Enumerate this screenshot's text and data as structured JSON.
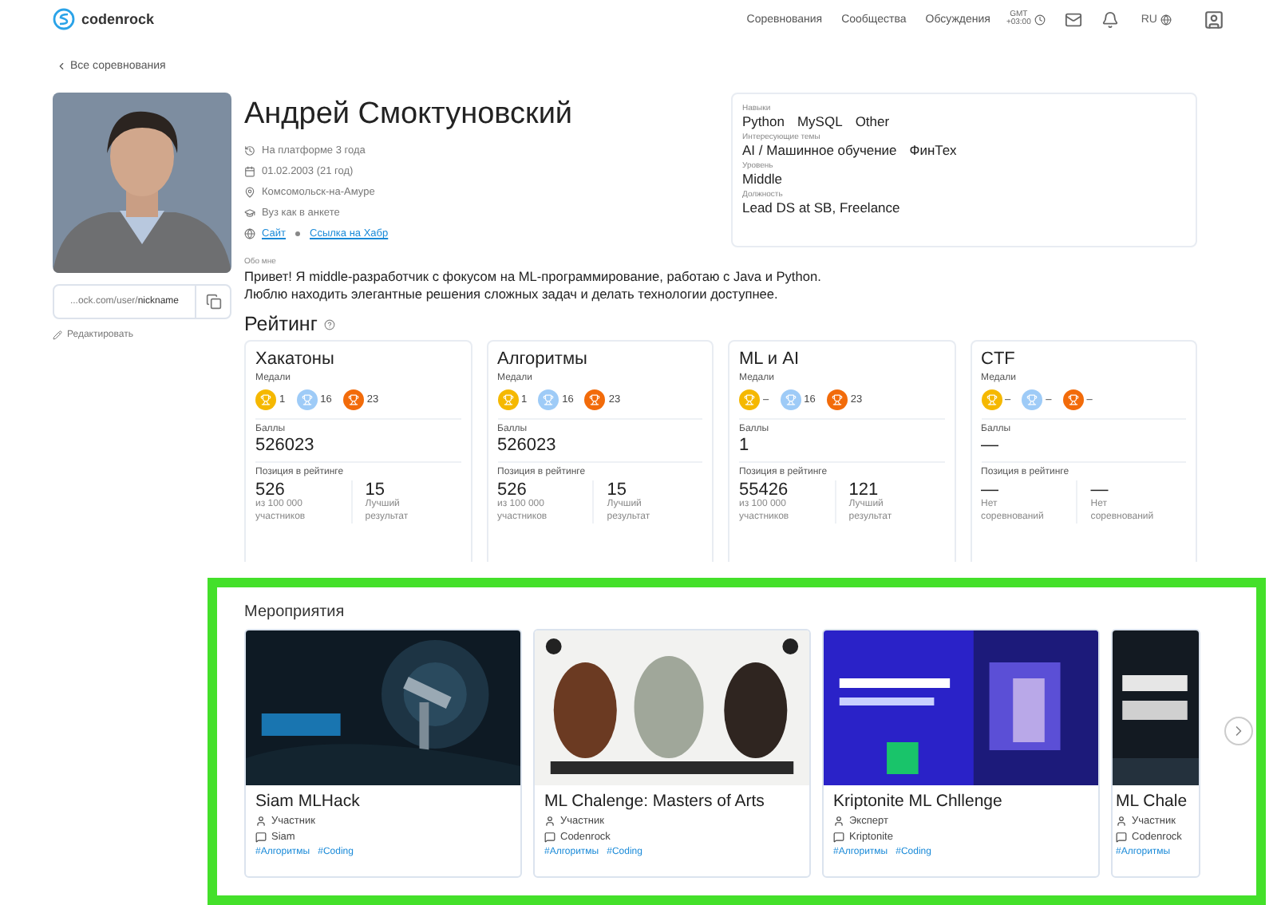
{
  "header": {
    "logo_text": "codenrock",
    "nav": [
      "Соревнования",
      "Сообщества",
      "Обсуждения"
    ],
    "timezone": [
      "GMT",
      "+03:00"
    ],
    "language": "RU"
  },
  "back_link": "Все соревнования",
  "profile": {
    "name": "Андрей Смоктуновский",
    "info": [
      {
        "kind": "platform",
        "text": "На платформе 3 года"
      },
      {
        "kind": "birthday",
        "text": "01.02.2003  (21 год)"
      },
      {
        "kind": "city",
        "text": "Комсомольск-на-Амуре"
      },
      {
        "kind": "university",
        "text": "Вуз как в анкете"
      }
    ],
    "links": [
      "Сайт",
      "Ссылка на Хабр"
    ],
    "profile_link": "...ock.com/user/**nickname**",
    "edit": "Редактировать"
  },
  "details": [
    {
      "label": "Навыки",
      "values": [
        "Python",
        "MySQL",
        "Other"
      ]
    },
    {
      "label": "Интересующие темы",
      "values": [
        "AI / Машинное обучение",
        "ФинТех"
      ]
    },
    {
      "label": "Уровень",
      "values": [
        "Middle"
      ]
    },
    {
      "label": "Должность",
      "values": [
        "Lead DS at SB, Freelance"
      ]
    }
  ],
  "about": {
    "label": "Обо мне",
    "lines": [
      "Привет! Я middle-разработчик с фокусом на ML-программирование, работаю с Java и Python.",
      "Люблю находить элегантные решения сложных задач и делать технологии доступнее."
    ]
  },
  "rating": {
    "title": "Рейтинг",
    "cards": [
      {
        "title": "Хакатоны",
        "medals_label": "Медали",
        "medals": [
          {
            "kind": "gold",
            "count": "1"
          },
          {
            "kind": "silver",
            "count": "16"
          },
          {
            "kind": "bronze",
            "count": "23"
          }
        ],
        "points_label": "Баллы",
        "points": "526023",
        "position_label": "Позиция в рейтинге",
        "position": {
          "value": "526",
          "note": "из 100 000 участников"
        },
        "best": {
          "value": "15",
          "note": "Лучший результат"
        }
      },
      {
        "title": "Алгоритмы",
        "medals_label": "Медали",
        "medals": [
          {
            "kind": "gold",
            "count": "1"
          },
          {
            "kind": "silver",
            "count": "16"
          },
          {
            "kind": "bronze",
            "count": "23"
          }
        ],
        "points_label": "Баллы",
        "points": "526023",
        "position_label": "Позиция в рейтинге",
        "position": {
          "value": "526",
          "note": "из 100 000 участников"
        },
        "best": {
          "value": "15",
          "note": "Лучший результат"
        }
      },
      {
        "title": "ML и AI",
        "medals_label": "Медали",
        "medals": [
          {
            "kind": "gold",
            "count": "–"
          },
          {
            "kind": "silver",
            "count": "16"
          },
          {
            "kind": "bronze",
            "count": "23"
          }
        ],
        "points_label": "Баллы",
        "points": "1",
        "position_label": "Позиция в рейтинге",
        "position": {
          "value": "55426",
          "note": "из 100 000 участников"
        },
        "best": {
          "value": "121",
          "note": "Лучший результат"
        }
      },
      {
        "title": "CTF",
        "medals_label": "Медали",
        "medals": [
          {
            "kind": "gold",
            "count": "–"
          },
          {
            "kind": "silver",
            "count": "–"
          },
          {
            "kind": "bronze",
            "count": "–"
          }
        ],
        "points_label": "Баллы",
        "points": "—",
        "position_label": "Позиция в рейтинге",
        "position": {
          "value": "—",
          "note": "Нет соревнований"
        },
        "best": {
          "value": "—",
          "note": "Нет соревнований"
        }
      }
    ]
  },
  "events": {
    "title": "Мероприятия",
    "cards": [
      {
        "title": "Siam MLHack",
        "role": "Участник",
        "organizer": "Siam",
        "tags": [
          "#Алгоритмы",
          "#Coding"
        ]
      },
      {
        "title": "ML Chalenge: Masters of Arts",
        "role": "Участник",
        "organizer": "Codenrock",
        "tags": [
          "#Алгоритмы",
          "#Coding"
        ]
      },
      {
        "title": "Kriptonite ML Chllenge",
        "role": "Эксперт",
        "organizer": "Kriptonite",
        "tags": [
          "#Алгоритмы",
          "#Coding"
        ]
      },
      {
        "title": "ML Chale",
        "role": "Участник",
        "organizer": "Codenrock",
        "tags": [
          "#Алгоритмы"
        ]
      }
    ]
  }
}
